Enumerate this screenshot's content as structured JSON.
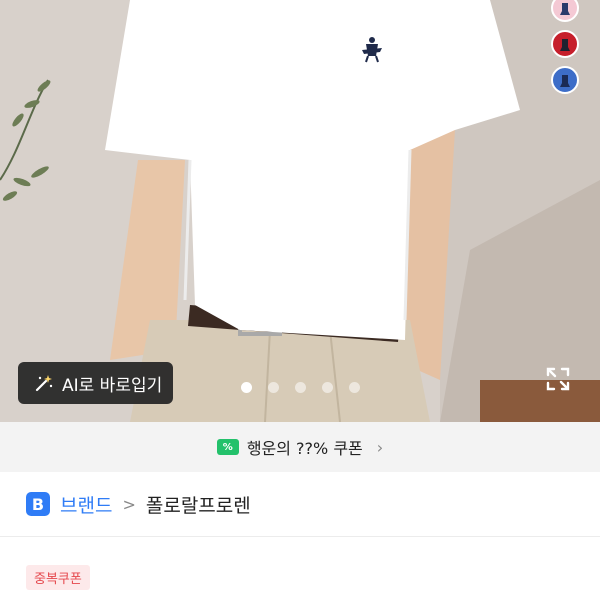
{
  "ai_button": {
    "label": "AI로 바로입기",
    "icon": "magic-wand-icon"
  },
  "carousel": {
    "count": 5,
    "active": 0
  },
  "swatches": [
    {
      "color": "#f4c9d4",
      "logo": "#2a3a6b"
    },
    {
      "color": "#c61f2b",
      "logo": "#1e2230"
    },
    {
      "color": "#3d6dc8",
      "logo": "#1a2a55"
    }
  ],
  "coupon": {
    "label": "행운의 ??% 쿠폰",
    "icon_text": "%"
  },
  "brand": {
    "badge": "B",
    "label": "브랜드",
    "separator": ">",
    "name": "폴로랄프로렌"
  },
  "badge": {
    "label": "중복쿠폰"
  },
  "colors": {
    "accent_blue": "#2f7cf6",
    "coupon_green": "#23c16b",
    "badge_red": "#e5484d"
  }
}
